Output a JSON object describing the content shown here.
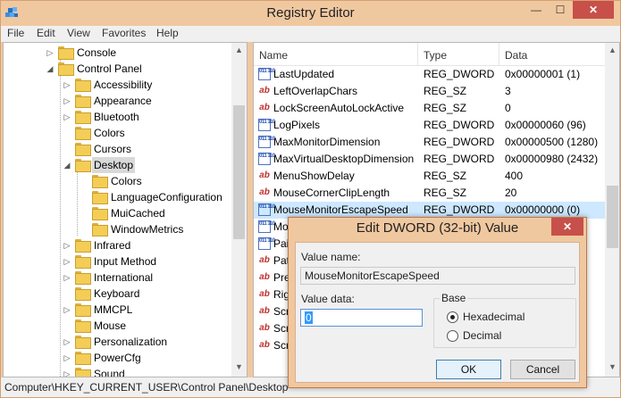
{
  "window": {
    "title": "Registry Editor",
    "controls": {
      "minimize": "—",
      "maximize": "☐",
      "close": "✕"
    }
  },
  "menu": [
    "File",
    "Edit",
    "View",
    "Favorites",
    "Help"
  ],
  "tree": {
    "items": [
      {
        "label": "Console",
        "arrow": "▷"
      },
      {
        "label": "Control Panel",
        "arrow": "◢"
      },
      {
        "label": "Accessibility",
        "arrow": "▷"
      },
      {
        "label": "Appearance",
        "arrow": "▷"
      },
      {
        "label": "Bluetooth",
        "arrow": "▷"
      },
      {
        "label": "Colors",
        "arrow": ""
      },
      {
        "label": "Cursors",
        "arrow": ""
      },
      {
        "label": "Desktop",
        "arrow": "◢"
      },
      {
        "label": "Colors",
        "arrow": ""
      },
      {
        "label": "LanguageConfiguration",
        "arrow": ""
      },
      {
        "label": "MuiCached",
        "arrow": ""
      },
      {
        "label": "WindowMetrics",
        "arrow": ""
      },
      {
        "label": "Infrared",
        "arrow": "▷"
      },
      {
        "label": "Input Method",
        "arrow": "▷"
      },
      {
        "label": "International",
        "arrow": "▷"
      },
      {
        "label": "Keyboard",
        "arrow": ""
      },
      {
        "label": "MMCPL",
        "arrow": "▷"
      },
      {
        "label": "Mouse",
        "arrow": ""
      },
      {
        "label": "Personalization",
        "arrow": "▷"
      },
      {
        "label": "PowerCfg",
        "arrow": "▷"
      },
      {
        "label": "Sound",
        "arrow": "▷"
      }
    ]
  },
  "list": {
    "columns": {
      "name": "Name",
      "type": "Type",
      "data": "Data"
    },
    "rows": [
      {
        "name": "LastUpdated",
        "type": "REG_DWORD",
        "data": "0x00000001 (1)",
        "icon": "dword"
      },
      {
        "name": "LeftOverlapChars",
        "type": "REG_SZ",
        "data": "3",
        "icon": "sz"
      },
      {
        "name": "LockScreenAutoLockActive",
        "type": "REG_SZ",
        "data": "0",
        "icon": "sz"
      },
      {
        "name": "LogPixels",
        "type": "REG_DWORD",
        "data": "0x00000060 (96)",
        "icon": "dword"
      },
      {
        "name": "MaxMonitorDimension",
        "type": "REG_DWORD",
        "data": "0x00000500 (1280)",
        "icon": "dword"
      },
      {
        "name": "MaxVirtualDesktopDimension",
        "type": "REG_DWORD",
        "data": "0x00000980 (2432)",
        "icon": "dword"
      },
      {
        "name": "MenuShowDelay",
        "type": "REG_SZ",
        "data": "400",
        "icon": "sz"
      },
      {
        "name": "MouseCornerClipLength",
        "type": "REG_SZ",
        "data": "20",
        "icon": "sz"
      },
      {
        "name": "MouseMonitorEscapeSpeed",
        "type": "REG_DWORD",
        "data": "0x00000000 (0)",
        "icon": "dword"
      },
      {
        "name": "Mo",
        "type": "",
        "data": "",
        "icon": "dword"
      },
      {
        "name": "Pai",
        "type": "",
        "data": "",
        "icon": "dword"
      },
      {
        "name": "Pat",
        "type": "",
        "data": "",
        "icon": "sz"
      },
      {
        "name": "Pre",
        "type": "",
        "data": "",
        "icon": "sz"
      },
      {
        "name": "Rig",
        "type": "",
        "data": "",
        "icon": "sz"
      },
      {
        "name": "Scr",
        "type": "",
        "data": "",
        "icon": "sz"
      },
      {
        "name": "Scr",
        "type": "",
        "data": "",
        "icon": "sz"
      },
      {
        "name": "Scr",
        "type": "",
        "data": "",
        "icon": "sz"
      }
    ]
  },
  "status": {
    "path": "Computer\\HKEY_CURRENT_USER\\Control Panel\\Desktop"
  },
  "dialog": {
    "title": "Edit DWORD (32-bit) Value",
    "close": "✕",
    "value_name_label": "Value name:",
    "value_name": "MouseMonitorEscapeSpeed",
    "value_data_label": "Value data:",
    "value_data": "0",
    "base_label": "Base",
    "hex_label": "Hexadecimal",
    "dec_label": "Decimal",
    "base_selected": "Hexadecimal",
    "ok_label": "OK",
    "cancel_label": "Cancel"
  },
  "icons": {
    "value_sz": "ab",
    "value_dword": "011 110"
  }
}
